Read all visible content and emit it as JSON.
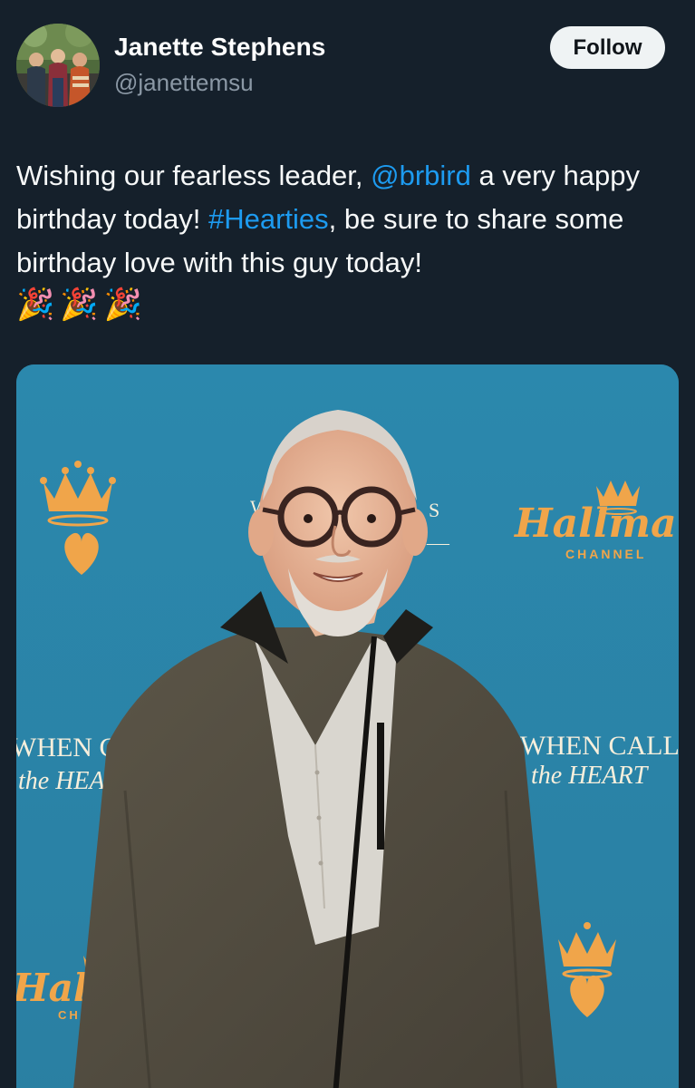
{
  "author": {
    "name": "Janette Stephens",
    "handle": "@janettemsu"
  },
  "follow_button": {
    "label": "Follow"
  },
  "tweet": {
    "text_before_mention": "Wishing our fearless leader, ",
    "mention": "@brbird",
    "text_after_mention": " a very happy birthday today! ",
    "hashtag": "#Hearties",
    "text_after_hashtag": ", be sure to share some birthday love with this guy today!",
    "emojis": [
      "🎉",
      "🎉",
      "🎉"
    ]
  },
  "media": {
    "backdrop": {
      "show_title_line1": "WHEN CALLS",
      "show_title_left_line1": "WHEN CA",
      "show_title_left_line2": "the HEA",
      "show_title_right_line1": "WHEN CALL",
      "show_title_right_line2": "the HEART",
      "network_script": "Hallmar",
      "network_script_left": "Hall",
      "network_channel": "CHANNEL",
      "network_channel_left": "CHA",
      "partial_top": "S"
    }
  },
  "colors": {
    "background": "#15202b",
    "link": "#1d9bf0",
    "secondary_text": "#8b98a5",
    "backdrop_blue": "#2e8bb0",
    "backdrop_gold": "#f0a54a"
  },
  "icons": {
    "avatar": "group-photo-avatar",
    "crown": "crown-icon",
    "heart": "heart-icon"
  }
}
